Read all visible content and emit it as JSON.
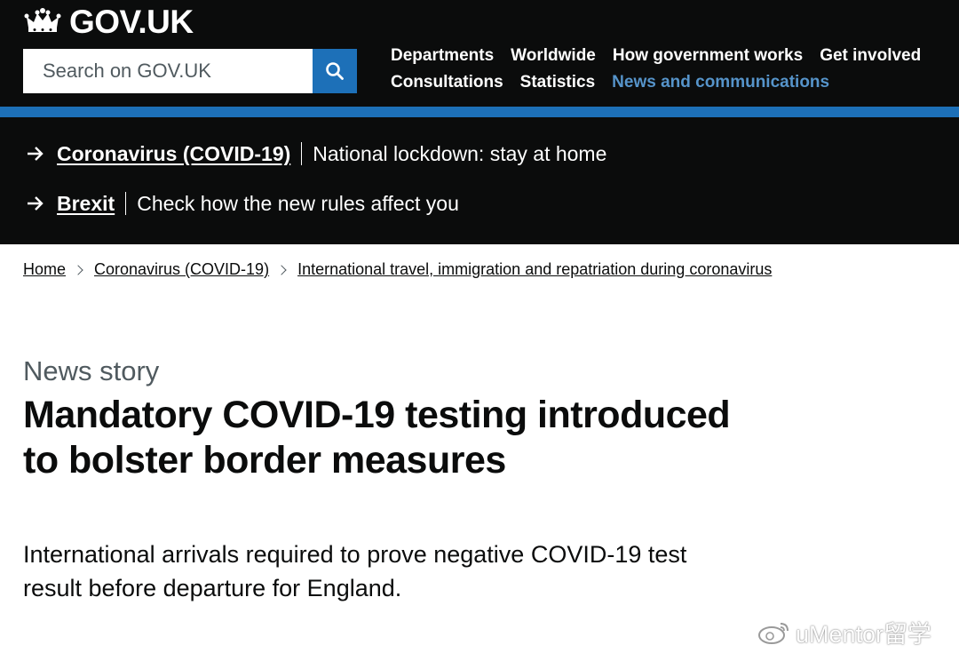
{
  "header": {
    "logo_text": "GOV.UK",
    "search_placeholder": "Search on GOV.UK",
    "nav_row1": [
      "Departments",
      "Worldwide",
      "How government works",
      "Get involved"
    ],
    "nav_row2": [
      "Consultations",
      "Statistics",
      "News and communications"
    ],
    "active_nav": "News and communications",
    "colors": {
      "background": "#0b0c0c",
      "accent": "#1d70b8",
      "active_link": "#5694ca"
    }
  },
  "banner": {
    "items": [
      {
        "link": "Coronavirus (COVID-19)",
        "text": "National lockdown: stay at home"
      },
      {
        "link": "Brexit",
        "text": "Check how the new rules affect you"
      }
    ]
  },
  "breadcrumb": [
    "Home",
    "Coronavirus (COVID-19)",
    "International travel, immigration and repatriation during coronavirus"
  ],
  "article": {
    "caption": "News story",
    "title": "Mandatory COVID-19 testing introduced to bolster border measures",
    "lead": "International arrivals required to prove negative COVID-19 test result before departure for England."
  },
  "watermark": {
    "text": "uMentor留学",
    "icon": "weibo-icon"
  }
}
